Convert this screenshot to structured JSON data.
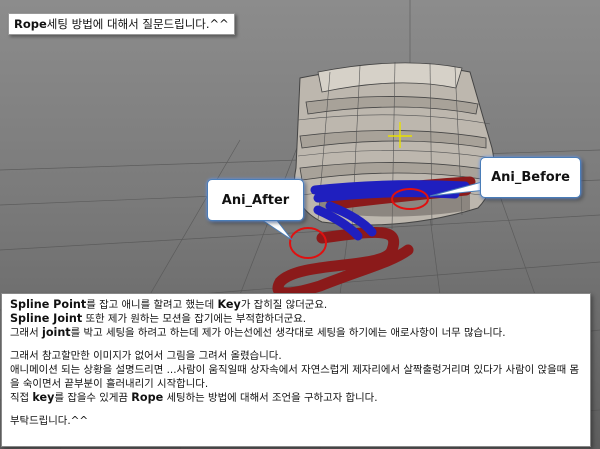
{
  "title": {
    "keyword": "Rope",
    "rest": "세팅 방법에 대해서 질문드립니다.^^"
  },
  "callouts": {
    "before": "Ani_Before",
    "after": "Ani_After"
  },
  "body": {
    "line1": {
      "kw1": "Spline Point",
      "t1": "를 잡고 애니를 할려고 했는데 ",
      "kw2": "Key",
      "t2": "가 잡히질 않더군요."
    },
    "line2": {
      "kw1": "Spline Joint",
      "t1": " 또한 제가 원하는 모션을 잡기에는 부적합하더군요."
    },
    "line3": {
      "t0": "그래서 ",
      "kw1": "joint",
      "t1": "를 박고 세팅을 하려고 하는데 제가 아는선에선 생각대로 세팅을 하기에는 애로사항이 너무 많습니다."
    },
    "line4": "그래서 참고할만한 이미지가 없어서 그림을 그려서 올렸습니다.",
    "line5": "애니메이션 되는 상황을 설명드리면 ...사람이 움직일때 상자속에서 자연스럽게 제자리에서 살짝출렁거리며 있다가 사람이 앉을때 몸을 숙이면서 끝부분이 흘러내리기 시작합니다.",
    "line6": {
      "t0": "직접 ",
      "kw1": "key",
      "t1": "를 잡을수 있게끔 ",
      "kw2": "Rope",
      "t2": " 세팅하는 방법에 대해서 조언을 구하고자 합니다."
    },
    "line7": "부탁드립니다.^^"
  },
  "colors": {
    "rope_red": "#8b1a1a",
    "rope_blue": "#1f1fbf",
    "highlight_red": "#e01010",
    "pivot_yellow": "#e8e000"
  }
}
